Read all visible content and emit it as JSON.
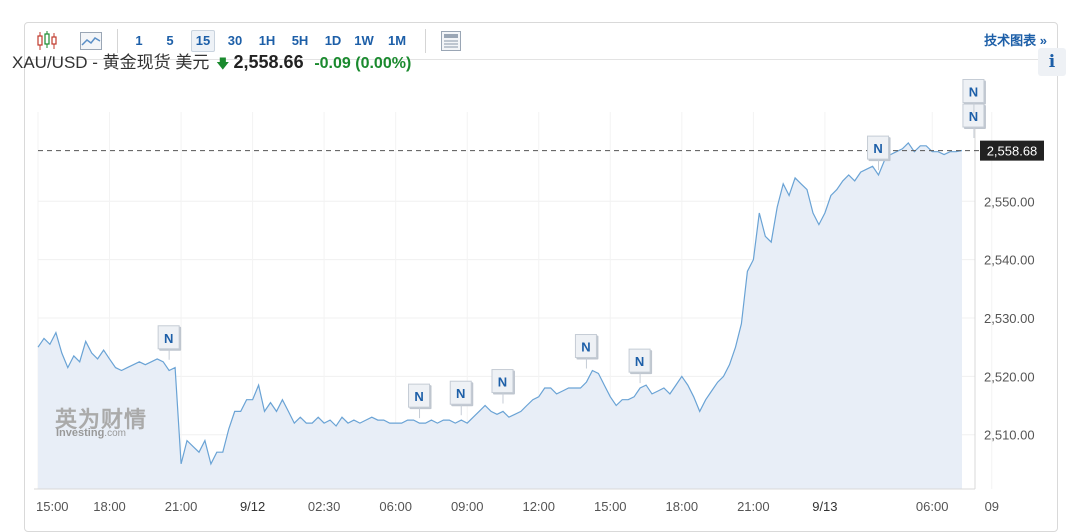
{
  "toolbar": {
    "icons": [
      "candlestick-icon",
      "area-chart-icon",
      "table-view-icon"
    ],
    "intervals": [
      "1",
      "5",
      "15",
      "30",
      "1H",
      "5H",
      "1D",
      "1W",
      "1M"
    ],
    "active_interval": "15",
    "right_link": "技术图表 »"
  },
  "quote": {
    "symbol": "XAU/USD - 黄金现货 美元",
    "direction": "down",
    "price": "2,558.66",
    "change": "-0.09 (0.00%)"
  },
  "info_button": "i",
  "watermark": {
    "cn": "英为财情",
    "en": "Investing",
    "suffix": ".com"
  },
  "colors": {
    "line": "#6aa3d5",
    "fill": "#e8eef7",
    "up": "#1a8a2e",
    "link": "#1d5fa8",
    "last_label_bg": "#222222"
  },
  "chart_data": {
    "type": "area",
    "symbol": "XAU/USD",
    "interval": "15",
    "x_ticks": [
      "15:00",
      "18:00",
      "21:00",
      "9/12",
      "02:30",
      "06:00",
      "09:00",
      "12:00",
      "15:00",
      "18:00",
      "21:00",
      "9/13",
      "06:00",
      "09"
    ],
    "date_ticks": [
      "9/12",
      "9/13"
    ],
    "y_ticks": [
      "2,510.00",
      "2,520.00",
      "2,530.00",
      "2,540.00",
      "2,550.00"
    ],
    "y_tick_values": [
      2510,
      2520,
      2530,
      2540,
      2550
    ],
    "ylim": [
      2500.7,
      2565.3
    ],
    "last_value": 2558.68,
    "last_value_label": "2,558.68",
    "grid": true,
    "x_tick_index": [
      0,
      12,
      24,
      36,
      48,
      60,
      72,
      84,
      96,
      108,
      120,
      132,
      150,
      160
    ],
    "values": [
      2525,
      2526.5,
      2525.5,
      2527.5,
      2524,
      2521.5,
      2523.5,
      2522.5,
      2526,
      2524,
      2523,
      2524.5,
      2523,
      2521.5,
      2521,
      2521.5,
      2522,
      2522.5,
      2522,
      2522.5,
      2523,
      2522.5,
      2521,
      2521.5,
      2505,
      2509,
      2508,
      2507,
      2509,
      2505,
      2507,
      2507,
      2511,
      2514,
      2514,
      2516,
      2516,
      2518.5,
      2514,
      2515.5,
      2514,
      2516,
      2514,
      2512,
      2513,
      2512,
      2512,
      2513,
      2512,
      2512.5,
      2511.5,
      2513,
      2512,
      2512.5,
      2512,
      2512.5,
      2513,
      2512.5,
      2512.5,
      2512,
      2512,
      2512,
      2512.5,
      2512.5,
      2512,
      2512,
      2512.5,
      2512,
      2512.5,
      2512.5,
      2512,
      2512.5,
      2512,
      2513,
      2514,
      2515,
      2514,
      2513.5,
      2514,
      2513,
      2513.5,
      2514,
      2515,
      2516,
      2516.5,
      2518,
      2518,
      2517,
      2517.5,
      2518,
      2518,
      2518,
      2519,
      2521,
      2520.5,
      2518.5,
      2516.5,
      2515,
      2516,
      2516,
      2516.5,
      2518,
      2518.5,
      2517,
      2517.5,
      2518,
      2517,
      2518.5,
      2520,
      2518.5,
      2516.5,
      2514,
      2516,
      2517.5,
      2519,
      2520,
      2522,
      2525,
      2529,
      2538,
      2540,
      2548,
      2544,
      2543,
      2549,
      2553,
      2551,
      2554,
      2553,
      2552,
      2548,
      2546,
      2548,
      2551,
      2552,
      2553.5,
      2554.5,
      2553.5,
      2555,
      2555.5,
      2556,
      2554.5,
      2557,
      2558,
      2558.5,
      2559,
      2560,
      2558.5,
      2559.5,
      2559.5,
      2558.5,
      2558.5,
      2558,
      2558.5,
      2558.5,
      2558.7
    ]
  },
  "markers": {
    "label": "N",
    "items": [
      {
        "index": 22,
        "value": 2522.5
      },
      {
        "index": 64,
        "value": 2512.5
      },
      {
        "index": 71,
        "value": 2513
      },
      {
        "index": 78,
        "value": 2515
      },
      {
        "index": 92,
        "value": 2521
      },
      {
        "index": 101,
        "value": 2518.5
      },
      {
        "index": 141,
        "value": 2555
      },
      {
        "index": 157,
        "value": 2560.5
      },
      {
        "index": 157,
        "value": 2564.7
      }
    ]
  }
}
